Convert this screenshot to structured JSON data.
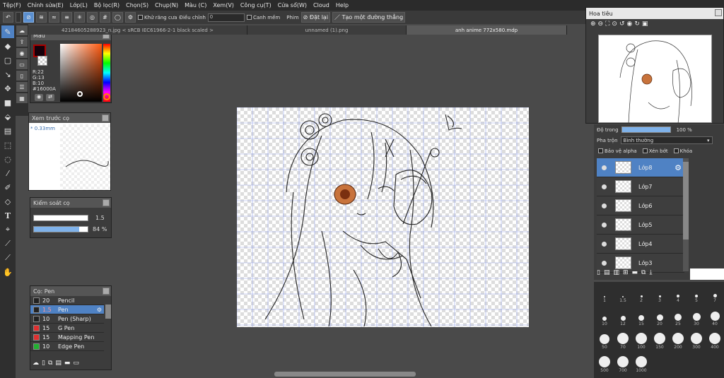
{
  "menu": [
    "Tệp(F)",
    "Chỉnh sửa(E)",
    "Lớp(L)",
    "Bộ lọc(R)",
    "Chọn(S)",
    "Chụp(N)",
    "Màu (C)",
    "Xem(V)",
    "Công cụ(T)",
    "Cửa sổ(W)",
    "Cloud",
    "Help"
  ],
  "toolbar": {
    "antialias": "Khử răng cưa",
    "correction_label": "Điều chỉnh",
    "correction_value": "0",
    "snap": "Canh mềm",
    "film": "Phim",
    "reset": "Đặt lại",
    "new_line": "Tạo một đường thẳng"
  },
  "tabs": [
    "42184605288923_n.jpg < sRCB IEC61966-2-1 black scaled >",
    "unnamed (1).png",
    "anh anime 772x580.mdp"
  ],
  "color_panel": {
    "title": "Màu",
    "r": "R:22",
    "g": "G:13",
    "b": "B:10",
    "hex": "#16000A",
    "fg": "#16000A"
  },
  "preview_panel": {
    "title": "Xem trước cọ",
    "size": "0.33mm"
  },
  "brush_control": {
    "title": "Kiểm soát cọ",
    "size": "1.5",
    "opacity": "84 %",
    "opacity_value": 0.84
  },
  "brush_list": {
    "title": "Cọ: Pen",
    "items": [
      {
        "size": "20",
        "name": "Pencil",
        "color": "#222222"
      },
      {
        "size": "1.5",
        "name": "Pen",
        "color": "#222222",
        "selected": true
      },
      {
        "size": "10",
        "name": "Pen (Sharp)",
        "color": "#222222"
      },
      {
        "size": "15",
        "name": "G Pen",
        "color": "#e03030"
      },
      {
        "size": "15",
        "name": "Mapping Pen",
        "color": "#e03030"
      },
      {
        "size": "10",
        "name": "Edge Pen",
        "color": "#20b030"
      }
    ]
  },
  "navigator": {
    "title": "Hoa tiêu"
  },
  "layers": {
    "opacity_label": "Độ trong",
    "opacity_value": "100 %",
    "opacity_fraction": 1.0,
    "blend_label": "Pha trộn",
    "blend_value": "Bình thường",
    "protect_alpha": "Bảo vệ alpha",
    "clipping": "Xén bớt",
    "lock": "Khóa",
    "items": [
      {
        "name": "Lớp8",
        "selected": true
      },
      {
        "name": "Lớp7"
      },
      {
        "name": "Lớp6"
      },
      {
        "name": "Lớp5"
      },
      {
        "name": "Lớp4"
      },
      {
        "name": "Lớp3"
      }
    ]
  },
  "brush_sizes": [
    "1",
    "1.5",
    "2",
    "3",
    "4",
    "5",
    "7",
    "10",
    "12",
    "15",
    "20",
    "25",
    "30",
    "40",
    "50",
    "70",
    "100",
    "150",
    "200",
    "300",
    "400",
    "500",
    "700",
    "1000"
  ]
}
